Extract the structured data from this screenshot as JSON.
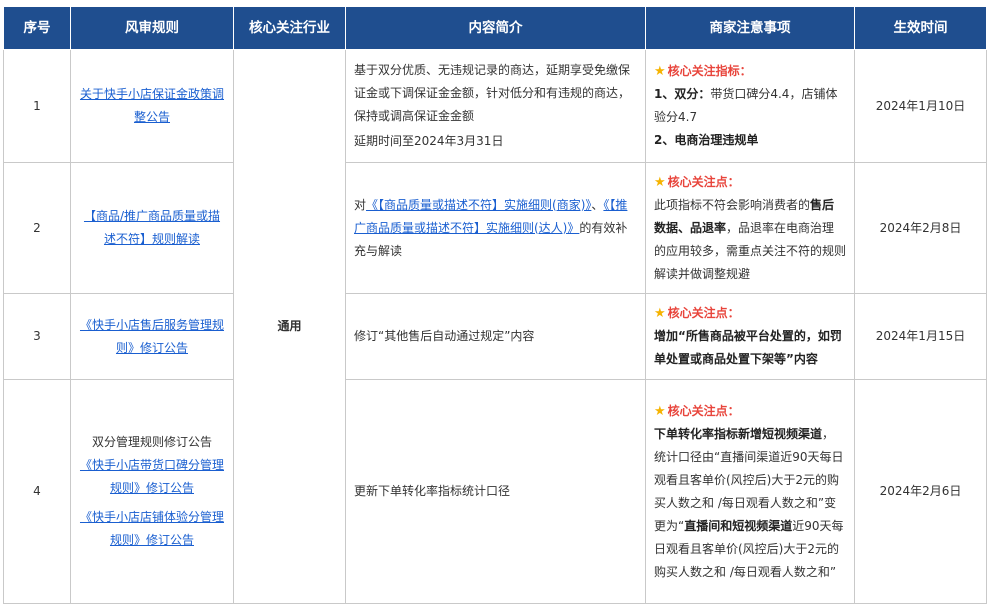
{
  "headers": [
    "序号",
    "风审规则",
    "核心关注行业",
    "内容简介",
    "商家注意事项",
    "生效时间"
  ],
  "industry": "通用",
  "rows": [
    {
      "no": "1",
      "rule_link": "关于快手小店保证金政策调整公告",
      "intro_p1": "基于双分优质、无违规记录的商达，延期享受免缴保证金或下调保证金金额，针对低分和有违规的商达，保持或调高保证金金额",
      "intro_p2": "延期时间至2024年3月31日",
      "note_head": "核心关注指标：",
      "note_1_bold": "1、双分：",
      "note_1_text": "带货口碑分4.4，店铺体验分4.7",
      "note_2_bold": "2、电商治理违规单",
      "date": "2024年1月10日"
    },
    {
      "no": "2",
      "rule_link": "【商品/推广商品质量或描述不符】规则解读",
      "intro_pre": "对",
      "intro_link1": "《【商品质量或描述不符】实施细则(商家)》",
      "intro_sep": "、",
      "intro_link2": "《【推广商品质量或描述不符】实施细则(达人)》",
      "intro_post": "的有效补充与解读",
      "note_head": "核心关注点：",
      "note_t1": "此项指标不符会影响消费者的",
      "note_b1": "售后数据、品退率",
      "note_t2": "，品退率在电商治理的应用较多，需重点关注不符的规则解读并做调整规避",
      "date": "2024年2月8日"
    },
    {
      "no": "3",
      "rule_link": "《快手小店售后服务管理规则》修订公告",
      "intro": "修订“其他售后自动通过规定”内容",
      "note_head": "核心关注点：",
      "note_bold": "增加“所售商品被平台处置的，如罚单处置或商品处置下架等”内容",
      "date": "2024年1月15日"
    },
    {
      "no": "4",
      "rule_title": "双分管理规则修订公告",
      "rule_link1": "《快手小店带货口碑分管理规则》修订公告",
      "rule_link2": "《快手小店店铺体验分管理规则》修订公告",
      "intro": "更新下单转化率指标统计口径",
      "note_head": "核心关注点：",
      "note_b1": "下单转化率指标新增短视频渠道",
      "note_t1": "，统计口径由“直播间渠道近90天每日观看且客单价(风控后)大于2元的购买人数之和 /每日观看人数之和”变更为“",
      "note_b2": "直播间和短视频渠道",
      "note_t2": "近90天每日观看且客单价(风控后)大于2元的购买人数之和 /每日观看人数之和”",
      "date": "2024年2月6日"
    }
  ],
  "colors": {
    "header_bg": "#1f4e8f",
    "link": "#1a5fd0",
    "note_head": "#e8453c",
    "star": "#f5b301"
  },
  "icons": {
    "note_star": "star-icon"
  }
}
